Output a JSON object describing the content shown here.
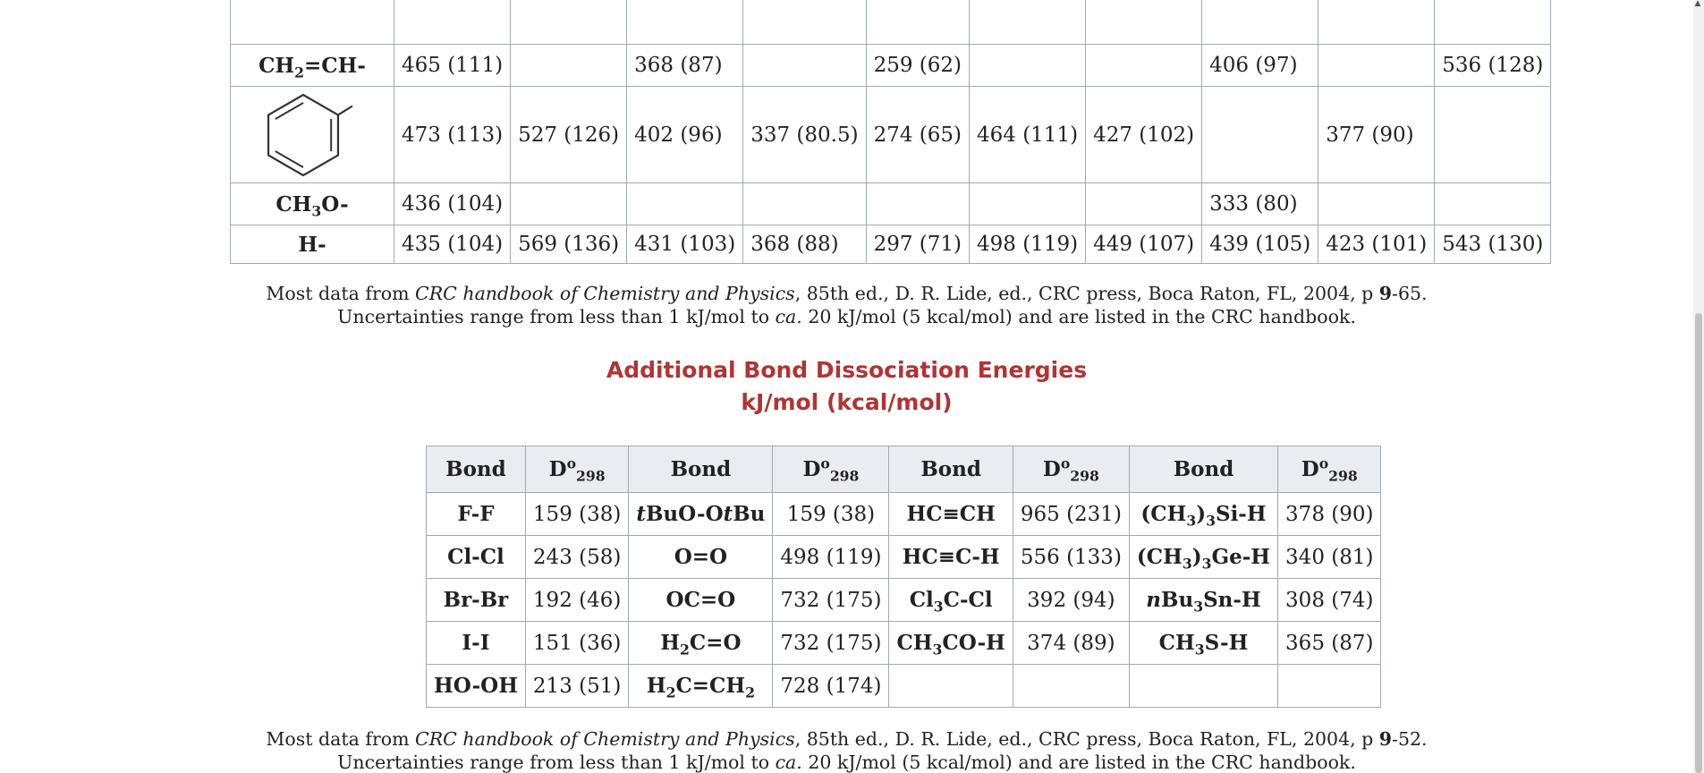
{
  "main_table": {
    "rows": [
      {
        "label": "",
        "cells": [
          "",
          "",
          "",
          "",
          "",
          "",
          "",
          "",
          "",
          ""
        ]
      },
      {
        "label": "CH2=CH-",
        "cells": [
          "465 (111)",
          "",
          "368 (87)",
          "",
          "259 (62)",
          "",
          "",
          "406 (97)",
          "",
          "536 (128)"
        ]
      },
      {
        "label": "",
        "cells": [
          "473 (113)",
          "527 (126)",
          "402 (96)",
          "337 (80.5)",
          "274 (65)",
          "464 (111)",
          "427 (102)",
          "",
          "377 (90)",
          ""
        ]
      },
      {
        "label": "CH3O-",
        "cells": [
          "436 (104)",
          "",
          "",
          "",
          "",
          "",
          "",
          "333 (80)",
          "",
          ""
        ]
      },
      {
        "label": "H-",
        "cells": [
          "435 (104)",
          "569 (136)",
          "431 (103)",
          "368 (88)",
          "297 (71)",
          "498 (119)",
          "449 (107)",
          "439 (105)",
          "423 (101)",
          "543 (130)"
        ]
      }
    ]
  },
  "note1": {
    "prefix": "Most data from ",
    "source": "CRC handbook of Chemistry and Physics",
    "middle": ", 85th ed., D. R. Lide, ed., CRC press, Boca Raton, FL, 2004, p ",
    "page_bold": "9",
    "page_rest": "-65.",
    "line2_prefix": "Uncertainties range from less than 1 kJ/mol to ",
    "line2_ca": "ca.",
    "line2_suffix": " 20 kJ/mol (5 kcal/mol) and are listed in the CRC handbook."
  },
  "section": {
    "title_line1": "Additional Bond Dissociation Energies",
    "title_line2": "kJ/mol (kcal/mol)"
  },
  "add_table": {
    "header_bond": "Bond",
    "header_d_main": "D",
    "header_d_sup": "o",
    "header_d_sub": "298",
    "rows": [
      [
        "F-F",
        "159 (38)",
        "tBuO-OtBu",
        "159 (38)",
        "HC≡CH",
        "965 (231)",
        "(CH3)3Si-H",
        "378 (90)"
      ],
      [
        "Cl-Cl",
        "243 (58)",
        "O=O",
        "498 (119)",
        "HC≡C-H",
        "556 (133)",
        "(CH3)3Ge-H",
        "340 (81)"
      ],
      [
        "Br-Br",
        "192 (46)",
        "OC=O",
        "732 (175)",
        "Cl3C-Cl",
        "392 (94)",
        "nBu3Sn-H",
        "308 (74)"
      ],
      [
        "I-I",
        "151 (36)",
        "H2C=O",
        "732 (175)",
        "CH3CO-H",
        "374 (89)",
        "CH3S-H",
        "365 (87)"
      ],
      [
        "HO-OH",
        "213 (51)",
        "H2C=CH2",
        "728 (174)",
        "",
        "",
        "",
        ""
      ]
    ]
  },
  "note2": {
    "prefix": "Most data from ",
    "source": "CRC handbook of Chemistry and Physics",
    "middle": ", 85th ed., D. R. Lide, ed., CRC press, Boca Raton, FL, 2004, p ",
    "page_bold": "9",
    "page_rest": "-52.",
    "line2_prefix": "Uncertainties range from less than 1 kJ/mol to ",
    "line2_ca": "ca.",
    "line2_suffix": " 20 kJ/mol (5 kcal/mol) and are listed in the CRC handbook."
  },
  "icons": {
    "benzene": "benzene-ring-structure",
    "phenyl": "phenyl-ring-structure"
  }
}
